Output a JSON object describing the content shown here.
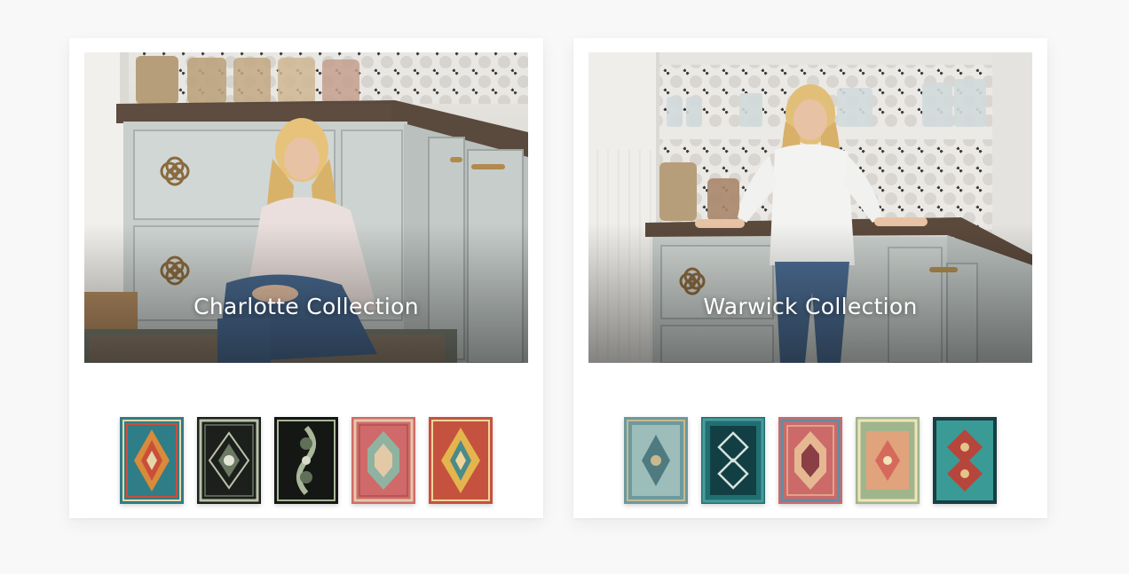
{
  "collections": [
    {
      "title": "Charlotte Collection",
      "rugs": [
        {
          "name": "teal-orange-rug",
          "colors": [
            "#2f7d86",
            "#d98a3a",
            "#c94f3b",
            "#e6d7a8"
          ]
        },
        {
          "name": "black-medallion-rug",
          "colors": [
            "#1c1f1c",
            "#b9c2a9",
            "#6c7a64",
            "#e3e6d6"
          ]
        },
        {
          "name": "black-floral-rug",
          "colors": [
            "#151714",
            "#a9b79a",
            "#5f6f58",
            "#d8dcc6"
          ]
        },
        {
          "name": "pink-sage-rug",
          "colors": [
            "#d06a6a",
            "#8fb3a0",
            "#e4c9a7",
            "#b24c53"
          ]
        },
        {
          "name": "red-gold-rug",
          "colors": [
            "#c5523e",
            "#e4b54d",
            "#4b8a8a",
            "#f0d59a"
          ]
        }
      ]
    },
    {
      "title": "Warwick Collection",
      "rugs": [
        {
          "name": "blue-grey-rug",
          "colors": [
            "#6c9a9e",
            "#9dbdbb",
            "#c9b98c",
            "#4f7b80"
          ]
        },
        {
          "name": "teal-white-rug",
          "colors": [
            "#1f6f73",
            "#d7e3de",
            "#4c9b99",
            "#123f44"
          ]
        },
        {
          "name": "rose-blue-rug",
          "colors": [
            "#cc6a6a",
            "#5d8fa6",
            "#e5b892",
            "#8a3f44"
          ]
        },
        {
          "name": "sage-peach-rug",
          "colors": [
            "#9fb68c",
            "#e0a37c",
            "#d56a5c",
            "#f2e3b9"
          ]
        },
        {
          "name": "aqua-red-rug",
          "colors": [
            "#3a9a96",
            "#b6463b",
            "#e4c48a",
            "#173f44"
          ]
        }
      ]
    }
  ]
}
